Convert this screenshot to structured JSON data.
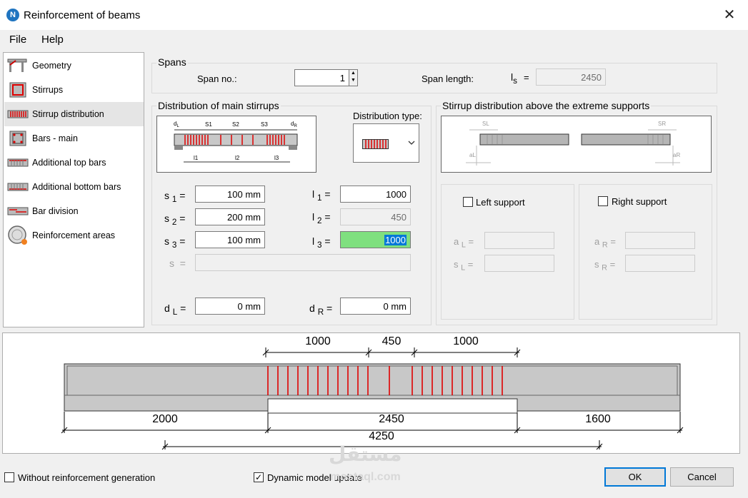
{
  "window": {
    "title": "Reinforcement of beams",
    "icon_letter": "N",
    "close_glyph": "✕"
  },
  "menu": [
    "File",
    "Help"
  ],
  "nav": [
    {
      "label": "Geometry",
      "icon": "geometry-icon"
    },
    {
      "label": "Stirrups",
      "icon": "stirrups-icon"
    },
    {
      "label": "Stirrup distribution",
      "icon": "stirrup-distribution-icon",
      "selected": true
    },
    {
      "label": "Bars - main",
      "icon": "bars-main-icon"
    },
    {
      "label": "Additional top bars",
      "icon": "additional-top-bars-icon"
    },
    {
      "label": "Additional bottom bars",
      "icon": "additional-bottom-bars-icon"
    },
    {
      "label": "Bar division",
      "icon": "bar-division-icon"
    },
    {
      "label": "Reinforcement areas",
      "icon": "reinforcement-areas-icon"
    }
  ],
  "spans": {
    "title": "Spans",
    "span_no_label": "Span no.:",
    "span_no_value": "1",
    "span_length_label": "Span length:",
    "ls_label": "l",
    "ls_sub": "s",
    "ls_eq": "=",
    "ls_value": "2450"
  },
  "main_stirrups": {
    "title": "Distribution of main stirrups",
    "distribution_type_label": "Distribution type:",
    "diagram_labels": {
      "dL": "d",
      "dLs": "L",
      "dR": "d",
      "dRs": "R",
      "s1": "S1",
      "s2": "S2",
      "s3": "S3",
      "l1": "l1",
      "l2": "l2",
      "l3": "l3"
    },
    "s1": {
      "label": "s",
      "sub": "1",
      "eq": "=",
      "value": "100 mm"
    },
    "s2": {
      "label": "s",
      "sub": "2",
      "eq": "=",
      "value": "200 mm"
    },
    "s3": {
      "label": "s",
      "sub": "3",
      "eq": "=",
      "value": "100 mm"
    },
    "s": {
      "label": "s",
      "eq": "=",
      "value": ""
    },
    "l1": {
      "label": "l",
      "sub": "1",
      "eq": "=",
      "value": "1000"
    },
    "l2": {
      "label": "l",
      "sub": "2",
      "eq": "=",
      "value": "450"
    },
    "l3": {
      "label": "l",
      "sub": "3",
      "eq": "=",
      "value": "1000"
    },
    "dL": {
      "label": "d",
      "sub": "L",
      "eq": "=",
      "value": "0 mm"
    },
    "dR": {
      "label": "d",
      "sub": "R",
      "eq": "=",
      "value": "0 mm"
    }
  },
  "extreme_supports": {
    "title": "Stirrup distribution above the extreme supports",
    "diagram_labels": {
      "sL": "SL",
      "sR": "SR",
      "aL": "aL",
      "aR": "aR"
    },
    "left_support_label": "Left support",
    "right_support_label": "Right support",
    "aL": {
      "label": "a",
      "sub": "L",
      "eq": "=",
      "value": ""
    },
    "sL": {
      "label": "s",
      "sub": "L",
      "eq": "=",
      "value": ""
    },
    "aR": {
      "label": "a",
      "sub": "R",
      "eq": "=",
      "value": ""
    },
    "sR": {
      "label": "s",
      "sub": "R",
      "eq": "=",
      "value": ""
    }
  },
  "preview": {
    "top_dims": [
      "1000",
      "450",
      "1000"
    ],
    "bottom_dims": [
      "2000",
      "2450",
      "1600"
    ],
    "total_dim": "4250"
  },
  "footer": {
    "without_generation_label": "Without reinforcement generation",
    "without_generation_checked": false,
    "dynamic_update_label": "Dynamic model update",
    "dynamic_update_checked": true,
    "ok_label": "OK",
    "cancel_label": "Cancel",
    "watermark_ar": "مستقل",
    "watermark_url": "mostaql.com"
  },
  "colors": {
    "stirrup_red": "#e00000",
    "beam_gray": "#c8c8c8",
    "highlight_green": "#7fe07f",
    "selection_blue": "#0078d7"
  }
}
